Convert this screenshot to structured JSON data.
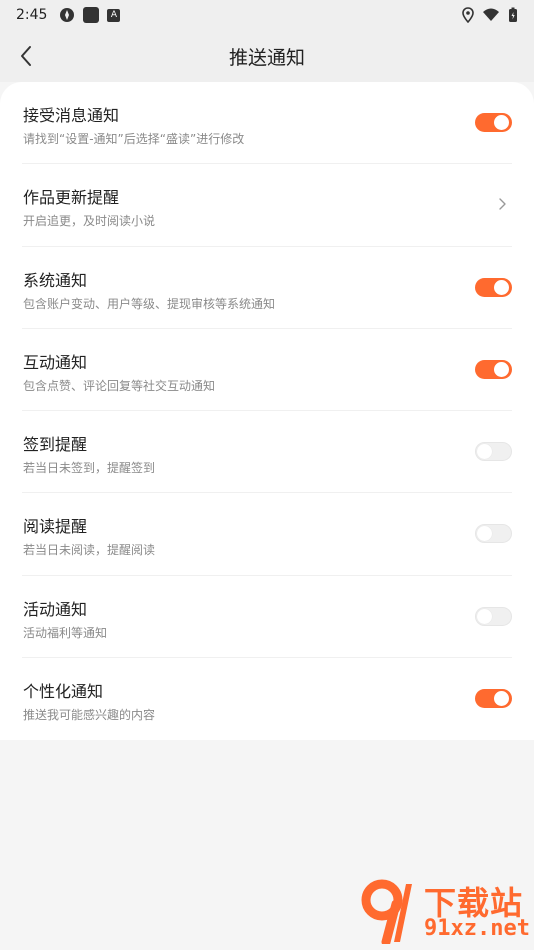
{
  "status_bar": {
    "time": "2:45"
  },
  "header": {
    "title": "推送通知"
  },
  "settings": [
    {
      "title": "接受消息通知",
      "subtitle": "请找到“设置-通知”后选择“盛读”进行修改",
      "control": "toggle",
      "on": true
    },
    {
      "title": "作品更新提醒",
      "subtitle": "开启追更，及时阅读小说",
      "control": "chevron"
    },
    {
      "title": "系统通知",
      "subtitle": "包含账户变动、用户等级、提现审核等系统通知",
      "control": "toggle",
      "on": true
    },
    {
      "title": "互动通知",
      "subtitle": "包含点赞、评论回复等社交互动通知",
      "control": "toggle",
      "on": true
    },
    {
      "title": "签到提醒",
      "subtitle": "若当日未签到，提醒签到",
      "control": "toggle",
      "on": false
    },
    {
      "title": "阅读提醒",
      "subtitle": "若当日未阅读，提醒阅读",
      "control": "toggle",
      "on": false
    },
    {
      "title": "活动通知",
      "subtitle": "活动福利等通知",
      "control": "toggle",
      "on": false
    },
    {
      "title": "个性化通知",
      "subtitle": "推送我可能感兴趣的内容",
      "control": "toggle",
      "on": true
    }
  ],
  "watermark": {
    "cn": "下载站",
    "en": "91xz.net"
  },
  "colors": {
    "accent": "#ff6a2f",
    "background": "#f5f5f5",
    "card": "#ffffff"
  }
}
